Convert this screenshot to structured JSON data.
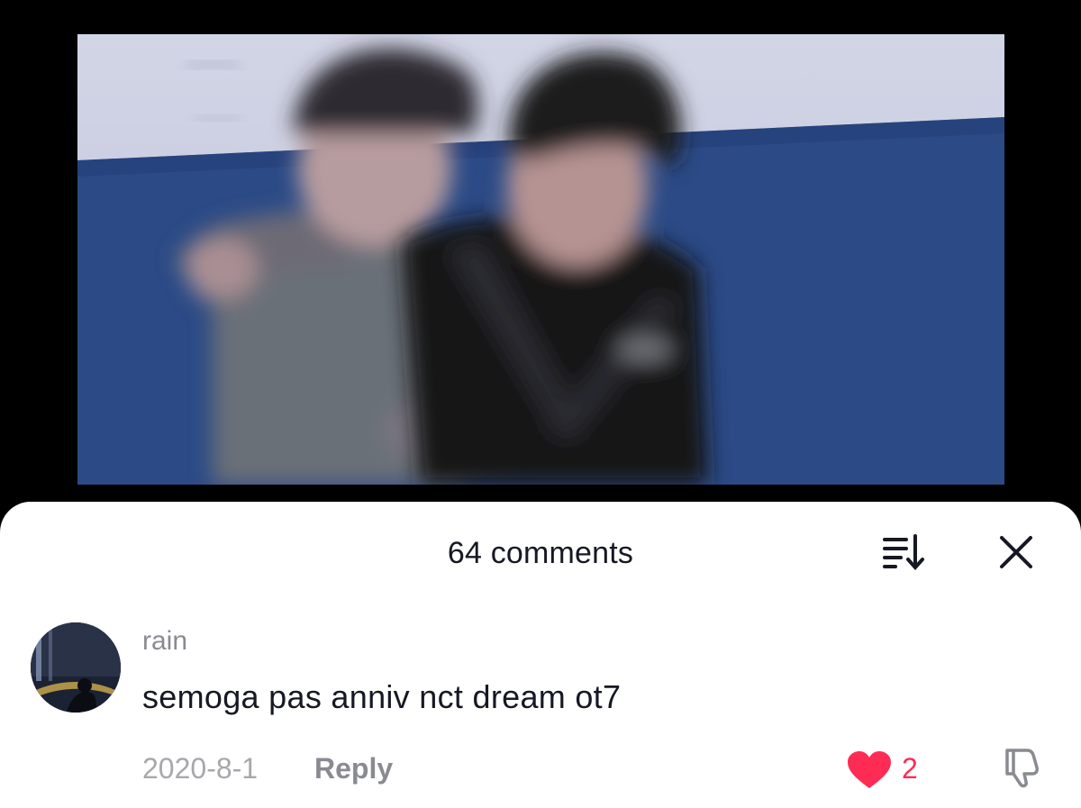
{
  "video": {
    "wall_color": "#2b4a86",
    "background_color": "#c9cde0"
  },
  "comments_sheet": {
    "count_label": "64 comments",
    "icons": {
      "sort": "sort-icon",
      "close": "close-icon"
    }
  },
  "comment": {
    "username": "rain",
    "text": "semoga pas anniv nct dream ot7",
    "date": "2020-8-1",
    "reply_label": "Reply",
    "likes": "2",
    "liked": true,
    "like_color": "#fe2c55",
    "icons": {
      "like": "heart-icon",
      "dislike": "thumbs-down-icon"
    }
  }
}
